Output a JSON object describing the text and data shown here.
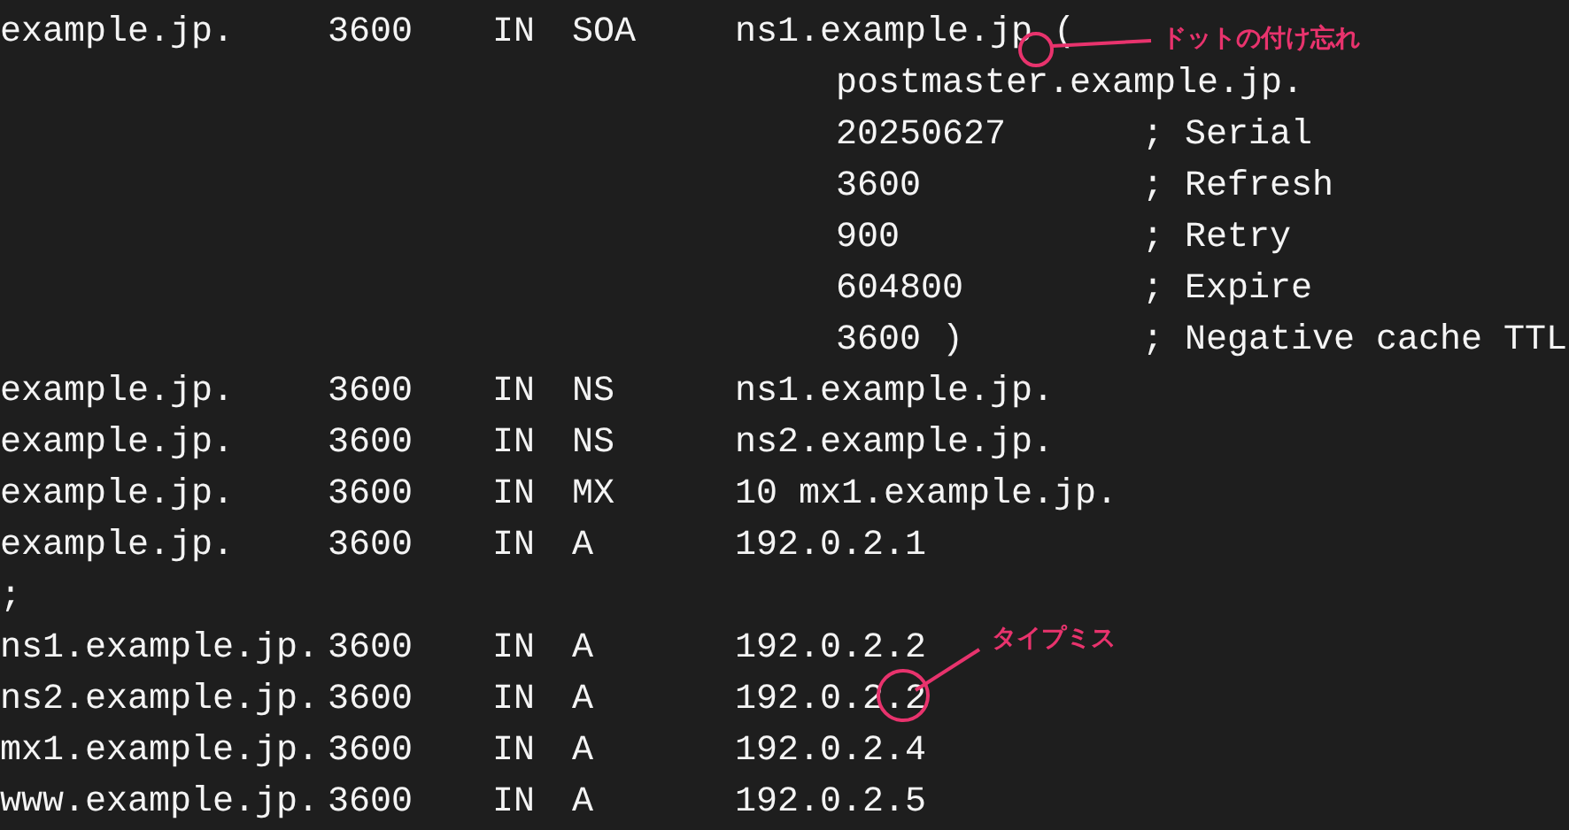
{
  "lines": [
    {
      "kind": "record",
      "name": "example.jp.",
      "ttl": "3600",
      "class": "IN",
      "type": "SOA",
      "data": "ns1.example.jp ("
    },
    {
      "kind": "continuation",
      "value": "postmaster.example.jp."
    },
    {
      "kind": "continuation",
      "value": "20250627",
      "comment": "; Serial"
    },
    {
      "kind": "continuation",
      "value": "3600",
      "comment": "; Refresh"
    },
    {
      "kind": "continuation",
      "value": "900",
      "comment": "; Retry"
    },
    {
      "kind": "continuation",
      "value": "604800",
      "comment": "; Expire"
    },
    {
      "kind": "continuation",
      "value": "3600 )",
      "comment": "; Negative cache TTL"
    },
    {
      "kind": "record",
      "name": "example.jp.",
      "ttl": "3600",
      "class": "IN",
      "type": "NS",
      "data": "ns1.example.jp."
    },
    {
      "kind": "record",
      "name": "example.jp.",
      "ttl": "3600",
      "class": "IN",
      "type": "NS",
      "data": "ns2.example.jp."
    },
    {
      "kind": "record",
      "name": "example.jp.",
      "ttl": "3600",
      "class": "IN",
      "type": "MX",
      "data": "10 mx1.example.jp."
    },
    {
      "kind": "record",
      "name": "example.jp.",
      "ttl": "3600",
      "class": "IN",
      "type": "A",
      "data": "192.0.2.1"
    },
    {
      "kind": "comment",
      "text": ";"
    },
    {
      "kind": "record",
      "name": "ns1.example.jp.",
      "ttl": "3600",
      "class": "IN",
      "type": "A",
      "data": "192.0.2.2"
    },
    {
      "kind": "record",
      "name": "ns2.example.jp.",
      "ttl": "3600",
      "class": "IN",
      "type": "A",
      "data": "192.0.2.2"
    },
    {
      "kind": "record",
      "name": "mx1.example.jp.",
      "ttl": "3600",
      "class": "IN",
      "type": "A",
      "data": "192.0.2.4"
    },
    {
      "kind": "record",
      "name": "www.example.jp.",
      "ttl": "3600",
      "class": "IN",
      "type": "A",
      "data": "192.0.2.5"
    }
  ],
  "annotations": [
    {
      "text": "ドットの付け忘れ"
    },
    {
      "text": "タイプミス"
    }
  ]
}
